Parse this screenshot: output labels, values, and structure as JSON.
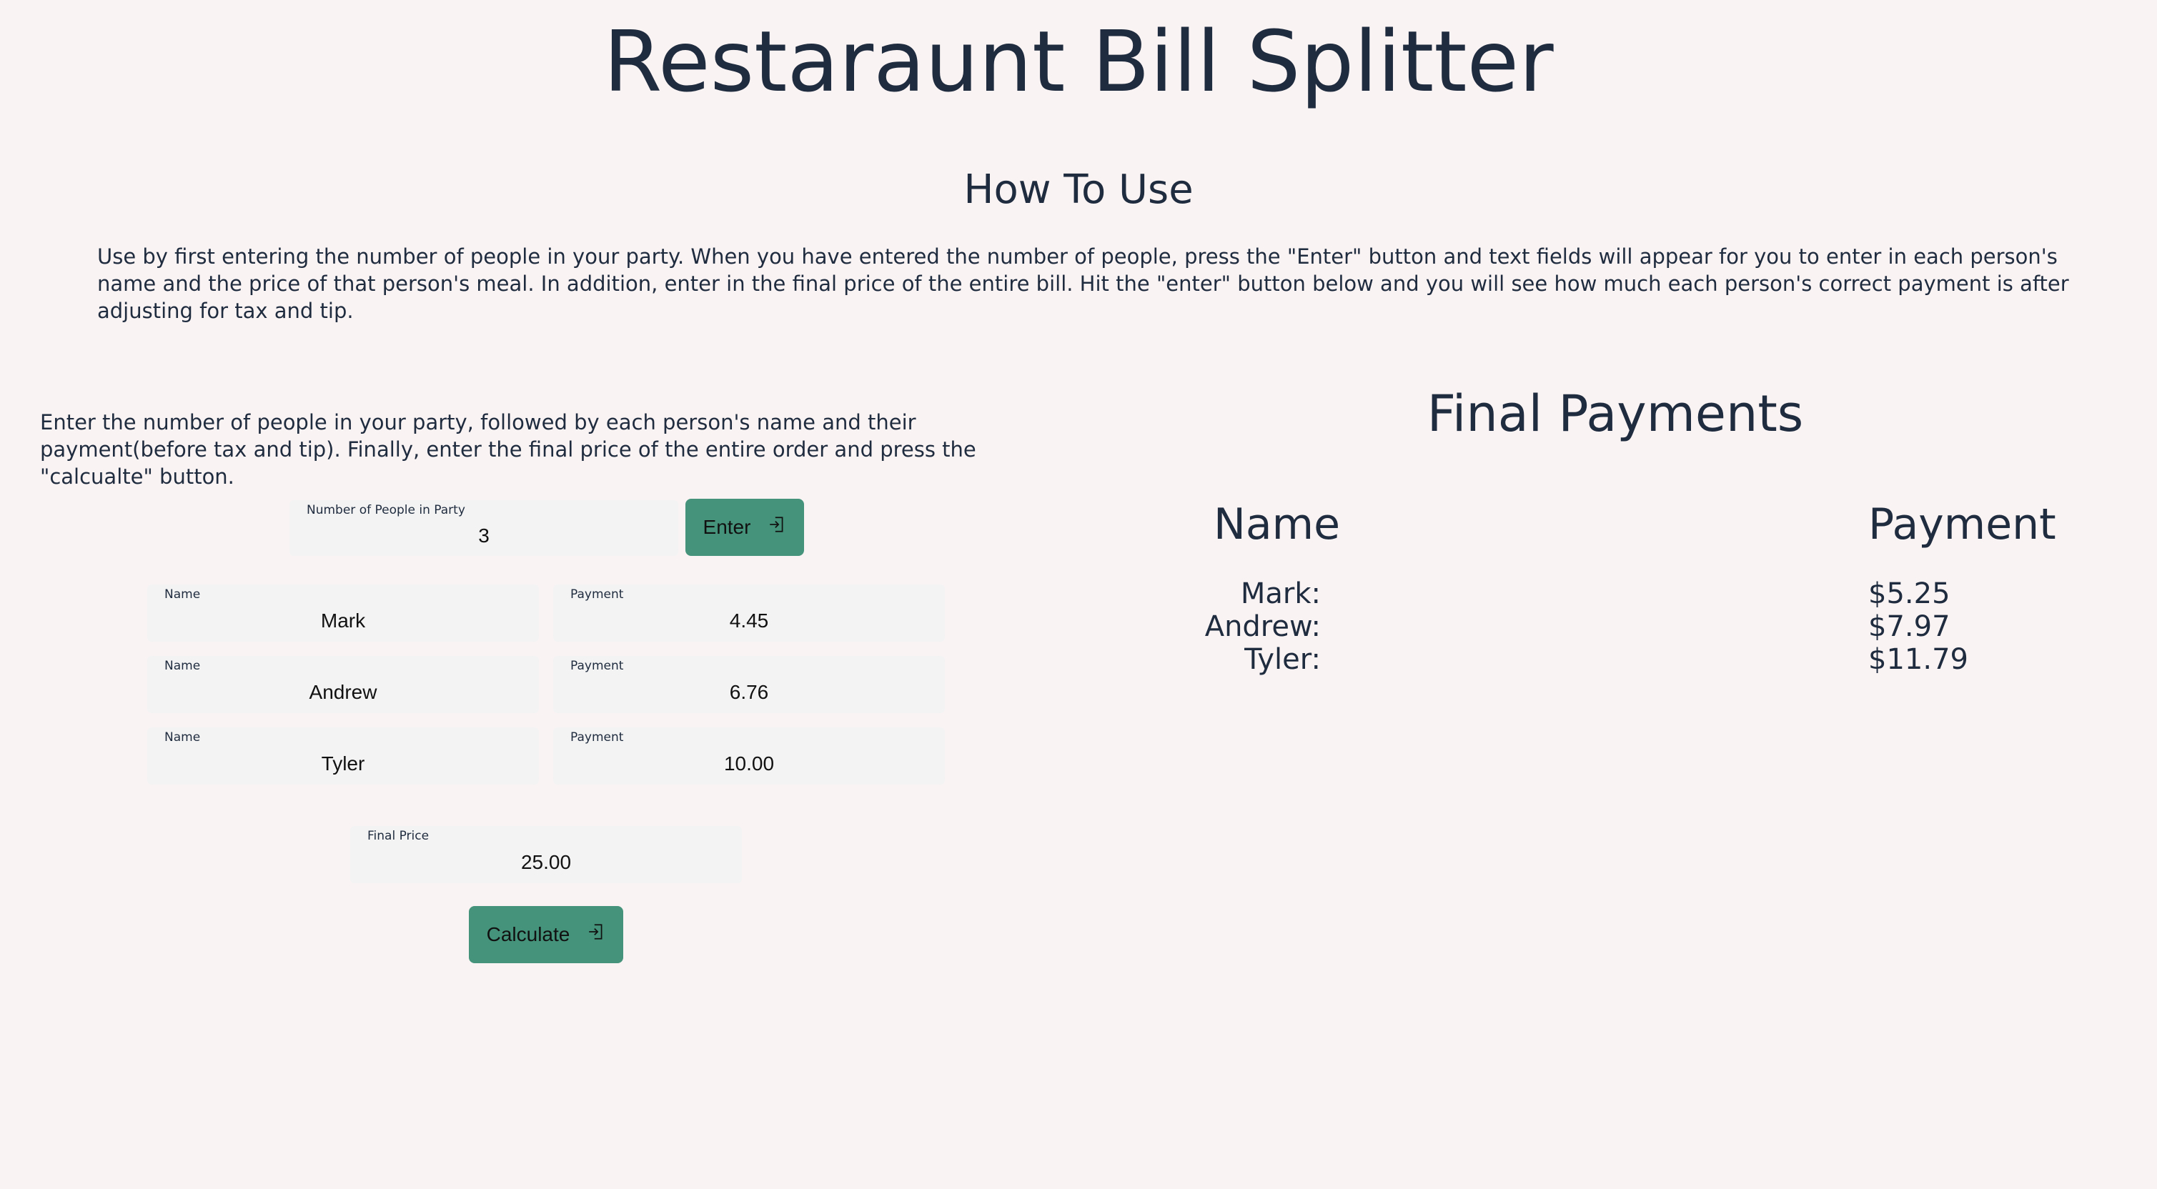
{
  "page": {
    "title": "Restaraunt Bill Splitter"
  },
  "how_to_use": {
    "heading": "How To Use",
    "text": "Use by first entering the number of people in your party. When you have entered the number of people, press the \"Enter\" button and text fields will appear for you to enter in each person's name and the price of that person's meal. In addition, enter in the final price of the entire bill. Hit the \"enter\" button below and you will see how much each person's correct payment is after adjusting for tax and tip."
  },
  "form": {
    "instructions": "Enter the number of people in your party, followed by each person's name and their payment(before tax and tip). Finally, enter the final price of the entire order and press the \"calcualte\" button.",
    "people_count": {
      "label": "Number of People in Party",
      "value": "3"
    },
    "enter_button": {
      "label": "Enter",
      "icon": "login-icon"
    },
    "people": [
      {
        "name_label": "Name",
        "name": "Mark",
        "payment_label": "Payment",
        "payment": "4.45"
      },
      {
        "name_label": "Name",
        "name": "Andrew",
        "payment_label": "Payment",
        "payment": "6.76"
      },
      {
        "name_label": "Name",
        "name": "Tyler",
        "payment_label": "Payment",
        "payment": "10.00"
      }
    ],
    "final_price": {
      "label": "Final Price",
      "value": "25.00"
    },
    "calculate_button": {
      "label": "Calculate",
      "icon": "login-icon"
    }
  },
  "results": {
    "heading": "Final Payments",
    "name_header": "Name",
    "payment_header": "Payment",
    "rows": [
      {
        "name": "Mark:",
        "payment": "$5.25"
      },
      {
        "name": "Andrew:",
        "payment": "$7.97"
      },
      {
        "name": "Tyler:",
        "payment": "$11.79"
      }
    ]
  },
  "colors": {
    "background": "#faf3f3",
    "text": "#1f2b3e",
    "button": "#44937a",
    "field": "#f3f3f3"
  }
}
